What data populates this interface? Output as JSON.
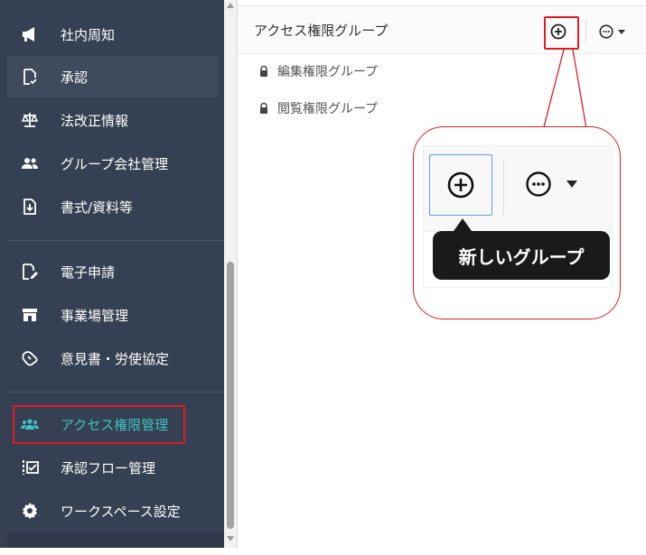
{
  "sidebar": {
    "items": [
      {
        "label": "社内周知",
        "icon": "megaphone-icon"
      },
      {
        "label": "承認",
        "icon": "approval-document-icon"
      },
      {
        "label": "法改正情報",
        "icon": "scales-icon"
      },
      {
        "label": "グループ会社管理",
        "icon": "group-users-icon"
      },
      {
        "label": "書式/資料等",
        "icon": "download-file-icon"
      },
      {
        "label": "電子申請",
        "icon": "e-application-icon"
      },
      {
        "label": "事業場管理",
        "icon": "store-icon"
      },
      {
        "label": "意見書・労使協定",
        "icon": "handshake-icon"
      },
      {
        "label": "アクセス権限管理",
        "icon": "access-users-icon"
      },
      {
        "label": "承認フロー管理",
        "icon": "flow-checklist-icon"
      },
      {
        "label": "ワークスペース設定",
        "icon": "gear-icon"
      }
    ],
    "selected_label": "承認",
    "active_label": "アクセス権限管理"
  },
  "panel": {
    "title": "アクセス権限グループ",
    "groups": [
      {
        "label": "編集権限グループ",
        "icon": "lock-icon"
      },
      {
        "label": "閲覧権限グループ",
        "icon": "lock-icon"
      }
    ]
  },
  "callout": {
    "tooltip": "新しいグループ"
  },
  "colors": {
    "sidebar_bg": "#354052",
    "active_text": "#3fc0c3",
    "highlight": "#e01b24",
    "focus_border": "#5aa0e8"
  }
}
